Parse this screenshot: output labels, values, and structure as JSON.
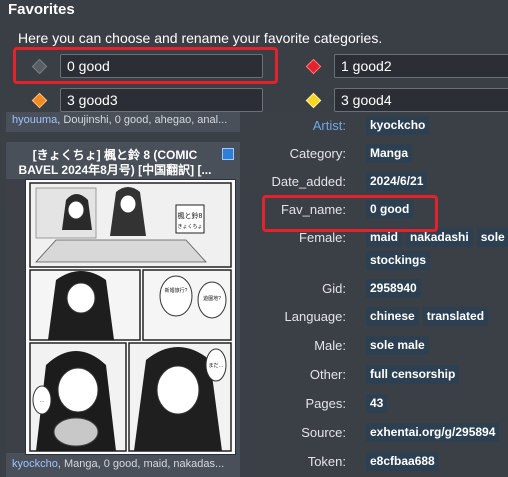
{
  "favorites": {
    "title": "Favorites",
    "description": "Here you can choose and rename your favorite categories.",
    "slots": [
      {
        "value": "0 good",
        "color": "#5a5e64"
      },
      {
        "value": "1 good2",
        "color": "#e3232b"
      },
      {
        "value": "3 good3",
        "color": "#f08a24"
      },
      {
        "value": "3 good4",
        "color": "#f6d523"
      }
    ]
  },
  "gallery": {
    "top_tags": {
      "artist": "hyouuma",
      "rest": ", Doujinshi, 0 good, ahegao, anal..."
    },
    "title": "[きょくちょ] 楓と鈴 8 (COMIC BAVEL 2024年8月号) [中国翻訳] [...",
    "bottom_tags": {
      "artist": "kyockcho",
      "rest": ", Manga, 0 good, maid, nakadas..."
    },
    "thumb_texts": [
      "楓と鈴8",
      "きょくちょ",
      "新婚旅行?",
      "遊園地?",
      "まだ…",
      "…"
    ]
  },
  "info": {
    "rows": [
      {
        "label": "Artist:",
        "link": true,
        "values": [
          "kyockcho"
        ]
      },
      {
        "label": "Category:",
        "values": [
          "Manga"
        ]
      },
      {
        "label": "Date_added:",
        "values": [
          "2024/6/21"
        ]
      },
      {
        "label": "Fav_name:",
        "values": [
          "0 good"
        ]
      },
      {
        "label": "Female:",
        "values": [
          "maid",
          "nakadashi",
          "sole",
          "stockings"
        ]
      },
      {
        "label": "Gid:",
        "values": [
          "2958940"
        ]
      },
      {
        "label": "Language:",
        "values": [
          "chinese",
          "translated"
        ]
      },
      {
        "label": "Male:",
        "values": [
          "sole male"
        ]
      },
      {
        "label": "Other:",
        "values": [
          "full censorship"
        ]
      },
      {
        "label": "Pages:",
        "values": [
          "43"
        ]
      },
      {
        "label": "Source:",
        "values": [
          "exhentai.org/g/295894"
        ]
      },
      {
        "label": "Token:",
        "values": [
          "e8cfbaa688"
        ]
      }
    ]
  }
}
